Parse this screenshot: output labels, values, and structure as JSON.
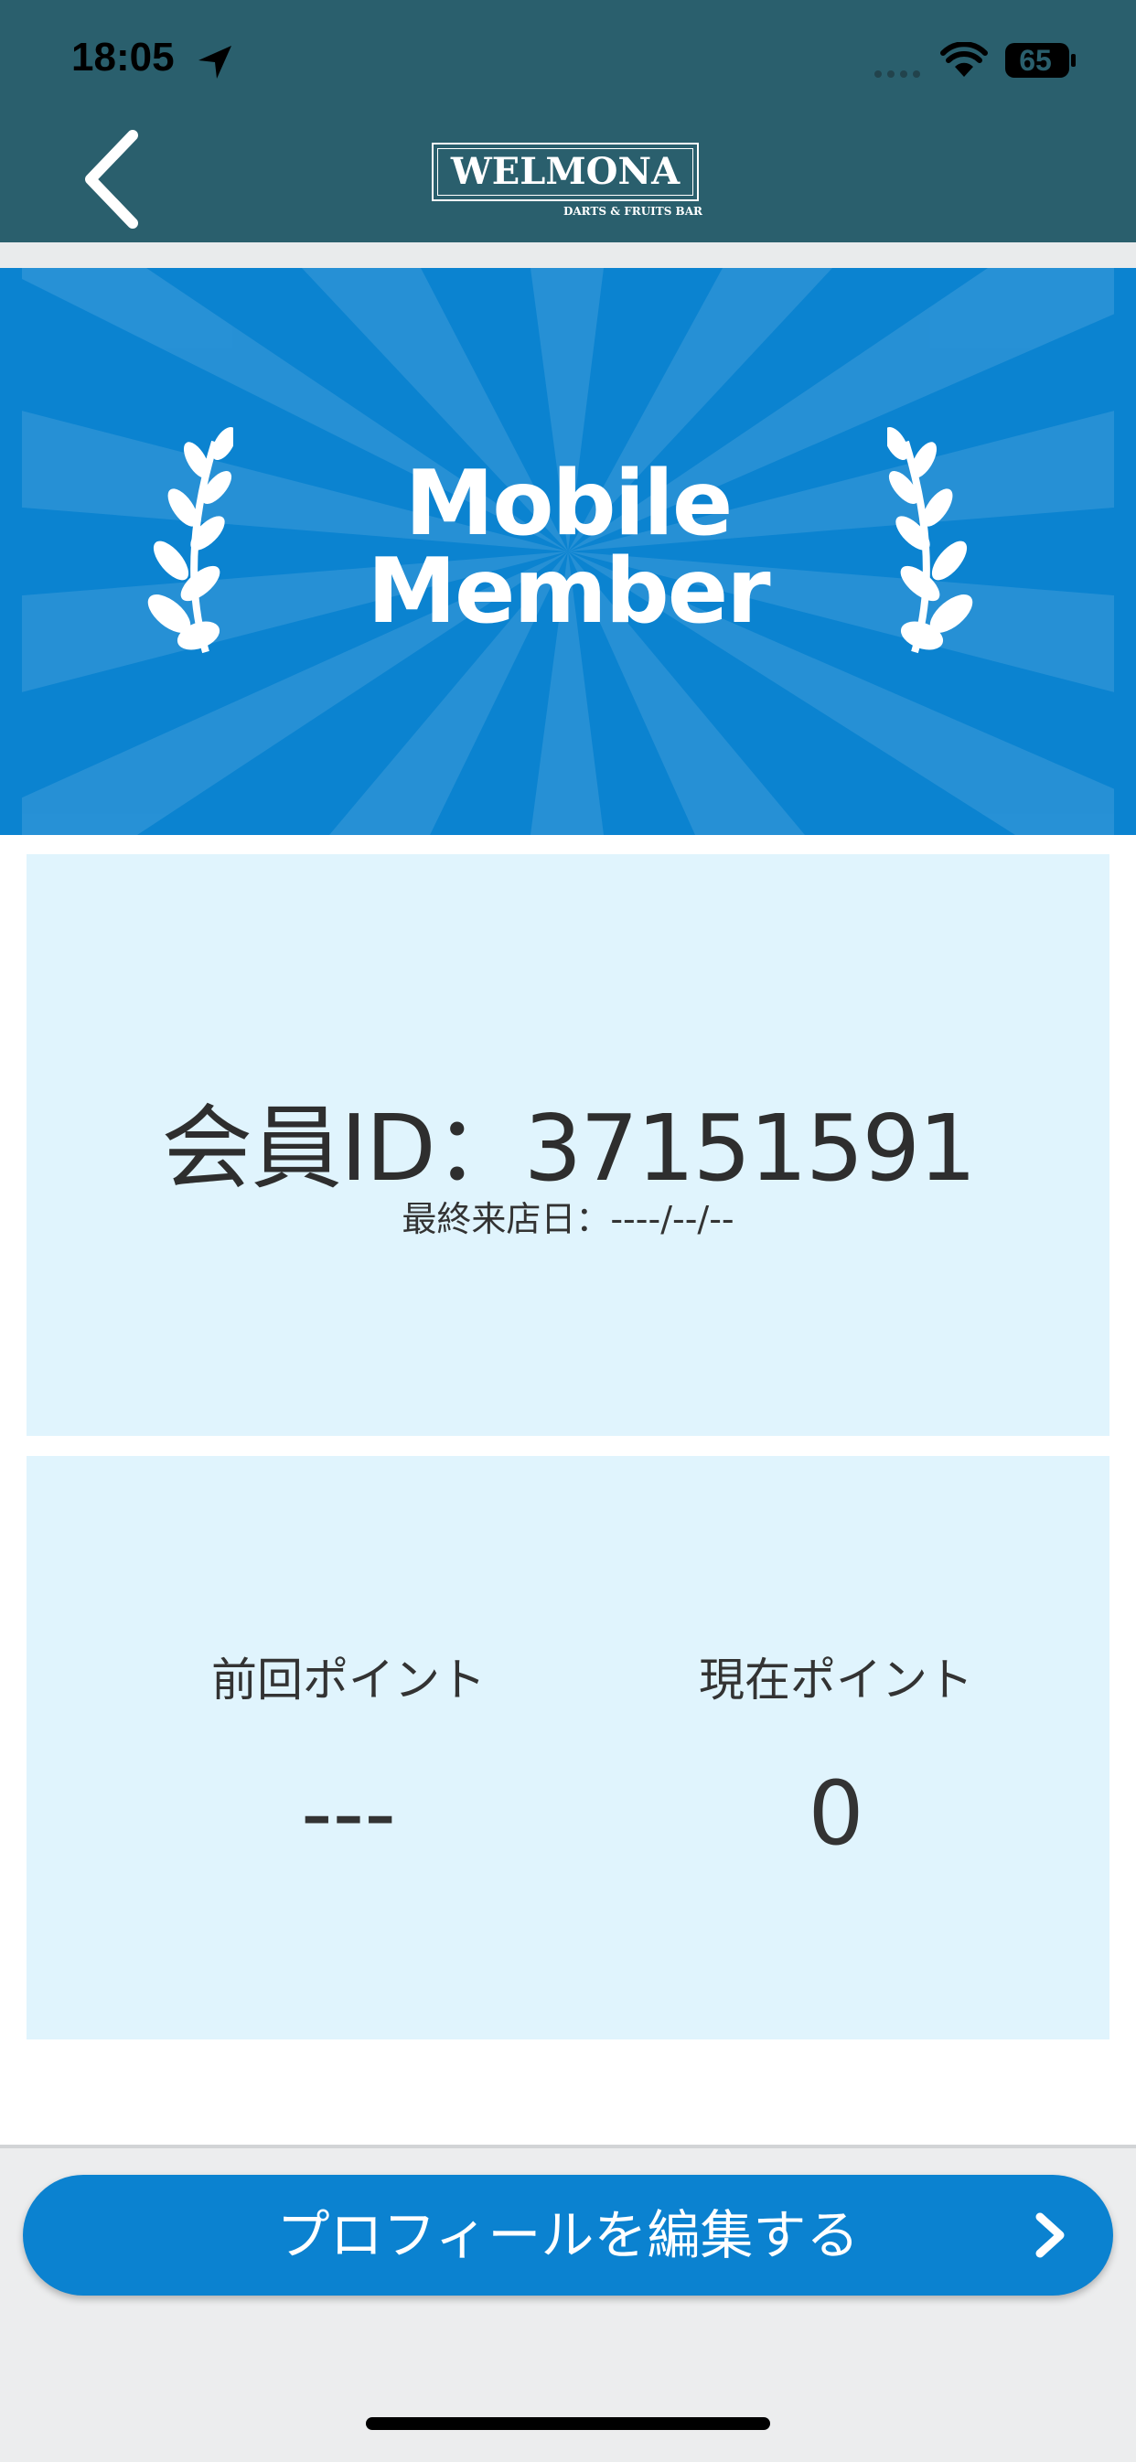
{
  "status_bar": {
    "time": "18:05",
    "battery": "65"
  },
  "header": {
    "logo_text": "WELMONA",
    "logo_subtext": "DARTS & FRUITS BAR"
  },
  "banner": {
    "title_line1": "Mobile",
    "title_line2": "Member"
  },
  "member": {
    "id_label": "会員ID：37151591",
    "last_visit_label": "最終来店日：----/--/--"
  },
  "points": {
    "previous_label": "前回ポイント",
    "previous_value": "---",
    "current_label": "現在ポイント",
    "current_value": "0"
  },
  "actions": {
    "edit_profile_label": "プロフィールを編集する"
  },
  "colors": {
    "header_bg": "#2a5f6d",
    "banner_bg": "#0b83d0",
    "card_bg": "#e0f4fd",
    "button_bg": "#0b82d0"
  }
}
